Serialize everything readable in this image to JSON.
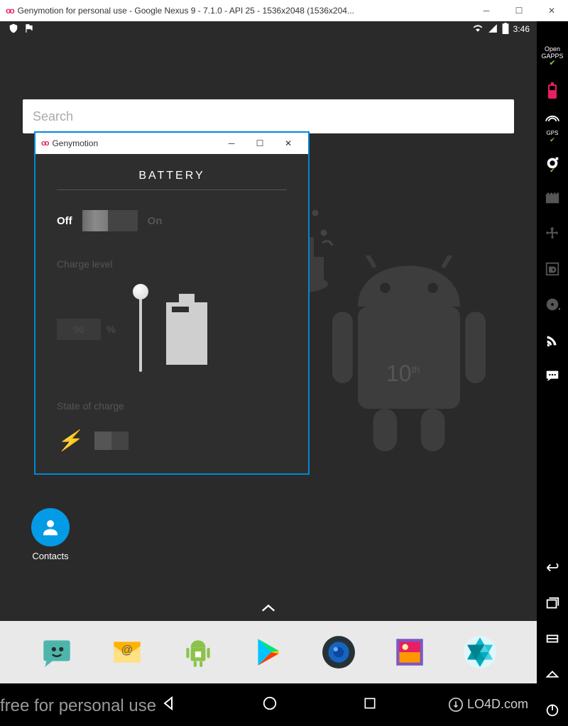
{
  "window": {
    "title": "Genymotion for personal use - Google Nexus 9 - 7.1.0 - API 25 - 1536x2048 (1536x204..."
  },
  "status": {
    "time": "3:46"
  },
  "search": {
    "placeholder": "Search"
  },
  "contacts": {
    "label": "Contacts"
  },
  "sidebar": {
    "opengapps": "Open\nGAPPS",
    "gps": "GPS"
  },
  "dialog": {
    "title": "Genymotion",
    "heading": "BATTERY",
    "off": "Off",
    "on": "On",
    "charge_label": "Charge level",
    "charge_value": "96",
    "pct": "%",
    "state_label": "State of charge"
  },
  "robot": {
    "tenth": "10",
    "th": "th"
  },
  "footer": "free for personal use",
  "watermark": "LO4D.com"
}
